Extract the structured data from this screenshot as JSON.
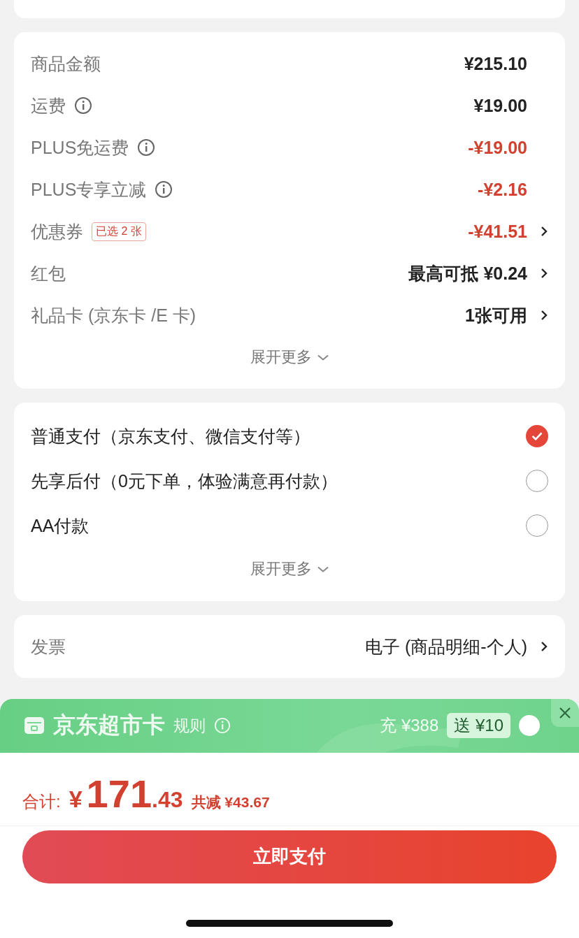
{
  "fees": {
    "rows": [
      {
        "label": "商品金额",
        "info": false,
        "value": "¥215.10",
        "discount": false,
        "arrow": false
      },
      {
        "label": "运费",
        "info": true,
        "value": "¥19.00",
        "discount": false,
        "arrow": false
      },
      {
        "label": "PLUS免运费",
        "info": true,
        "value": "-¥19.00",
        "discount": true,
        "arrow": false
      },
      {
        "label": "PLUS专享立减",
        "info": true,
        "value": "-¥2.16",
        "discount": true,
        "arrow": false
      },
      {
        "label": "优惠券",
        "info": false,
        "tag": "已选 2 张",
        "value": "-¥41.51",
        "discount": true,
        "arrow": true
      },
      {
        "label": "红包",
        "info": false,
        "value": "最高可抵 ¥0.24",
        "discount": false,
        "arrow": true
      },
      {
        "label": "礼品卡 (京东卡 /E 卡)",
        "info": false,
        "value": "1张可用",
        "discount": false,
        "arrow": true
      }
    ],
    "expand": "展开更多"
  },
  "payment": {
    "options": [
      {
        "label": "普通支付（京东支付、微信支付等）",
        "selected": true
      },
      {
        "label": "先享后付（0元下单，体验满意再付款）",
        "selected": false
      },
      {
        "label": "AA付款",
        "selected": false
      }
    ],
    "expand": "展开更多"
  },
  "invoice": {
    "label": "发票",
    "value": "电子 (商品明细-个人)"
  },
  "promo": {
    "title": "京东超市卡",
    "rules": "规则",
    "recharge": "充 ¥388",
    "bonus": "送 ¥10",
    "checked": false
  },
  "total": {
    "label": "合计:",
    "currency": "¥",
    "integer": "171",
    "decimal": ".43",
    "saved": "共减 ¥43.67"
  },
  "pay_button": "立即支付"
}
